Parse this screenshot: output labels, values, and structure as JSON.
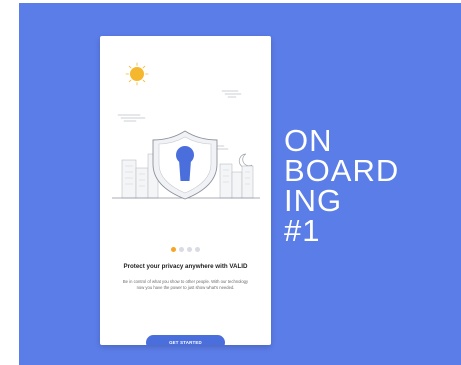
{
  "colors": {
    "background": "#5b7de8",
    "card": "#ffffff",
    "accent": "#4a6fdc",
    "active_dot": "#f5a623",
    "inactive_dot": "#d8dbe3",
    "sun": "#f5b72d",
    "keyhole": "#4a6fdc"
  },
  "onboarding": {
    "headline": "Protect your privacy anywhere with VALID",
    "body": "Be in control of what you show to other people. With our technology now you have the power to just show what's needed.",
    "cta_label": "GET STARTED",
    "pagination": {
      "total": 4,
      "active": 1
    }
  },
  "title": {
    "lines": [
      "ON",
      "BOARD",
      "ING",
      "#1"
    ]
  },
  "icons": [
    "sun-icon",
    "cloud-icon",
    "shield-lock-icon",
    "moon-icon",
    "city-skyline-icon"
  ]
}
